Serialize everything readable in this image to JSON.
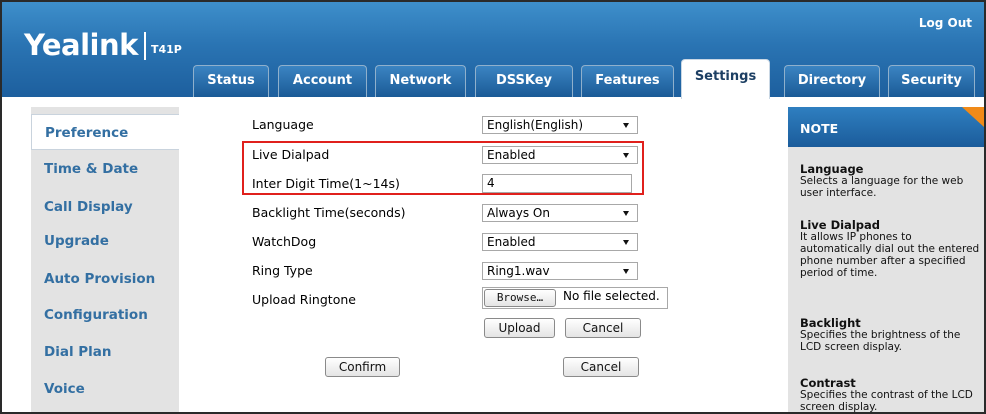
{
  "header": {
    "logo": "Yealink",
    "model": "T41P",
    "logout": "Log Out"
  },
  "tabs": [
    {
      "label": "Status"
    },
    {
      "label": "Account"
    },
    {
      "label": "Network"
    },
    {
      "label": "DSSKey"
    },
    {
      "label": "Features"
    },
    {
      "label": "Settings",
      "active": true
    },
    {
      "label": "Directory"
    },
    {
      "label": "Security"
    }
  ],
  "sidebar": {
    "items": [
      {
        "label": "Preference",
        "active": true
      },
      {
        "label": "Time & Date"
      },
      {
        "label": "Call Display"
      },
      {
        "label": "Upgrade"
      },
      {
        "label": "Auto Provision"
      },
      {
        "label": "Configuration"
      },
      {
        "label": "Dial Plan"
      },
      {
        "label": "Voice"
      }
    ]
  },
  "form": {
    "language": {
      "label": "Language",
      "value": "English(English)"
    },
    "live_dialpad": {
      "label": "Live Dialpad",
      "value": "Enabled"
    },
    "inter_digit": {
      "label": "Inter Digit Time(1~14s)",
      "value": "4"
    },
    "backlight": {
      "label": "Backlight Time(seconds)",
      "value": "Always On"
    },
    "watchdog": {
      "label": "WatchDog",
      "value": "Enabled"
    },
    "ring_type": {
      "label": "Ring Type",
      "value": "Ring1.wav"
    },
    "upload_ringtone": {
      "label": "Upload Ringtone",
      "browse": "Browse…",
      "status": "No file selected."
    },
    "upload_button": "Upload",
    "upload_cancel": "Cancel",
    "confirm": "Confirm",
    "cancel": "Cancel"
  },
  "note": {
    "title": "NOTE",
    "sections": [
      {
        "heading": "Language",
        "text": "Selects a language for the web user interface."
      },
      {
        "heading": "Live Dialpad",
        "text": "It allows IP phones to automatically dial out the entered phone number after a specified period of time."
      },
      {
        "heading": "Backlight",
        "text": "Specifies the brightness of the LCD screen display."
      },
      {
        "heading": "Contrast",
        "text": "Specifies the contrast of the LCD screen display."
      }
    ]
  },
  "colors": {
    "header_blue": "#2a74b3",
    "sidebar_text": "#336fa2",
    "highlight_red": "#e0201c",
    "note_accent": "#f08a18"
  }
}
